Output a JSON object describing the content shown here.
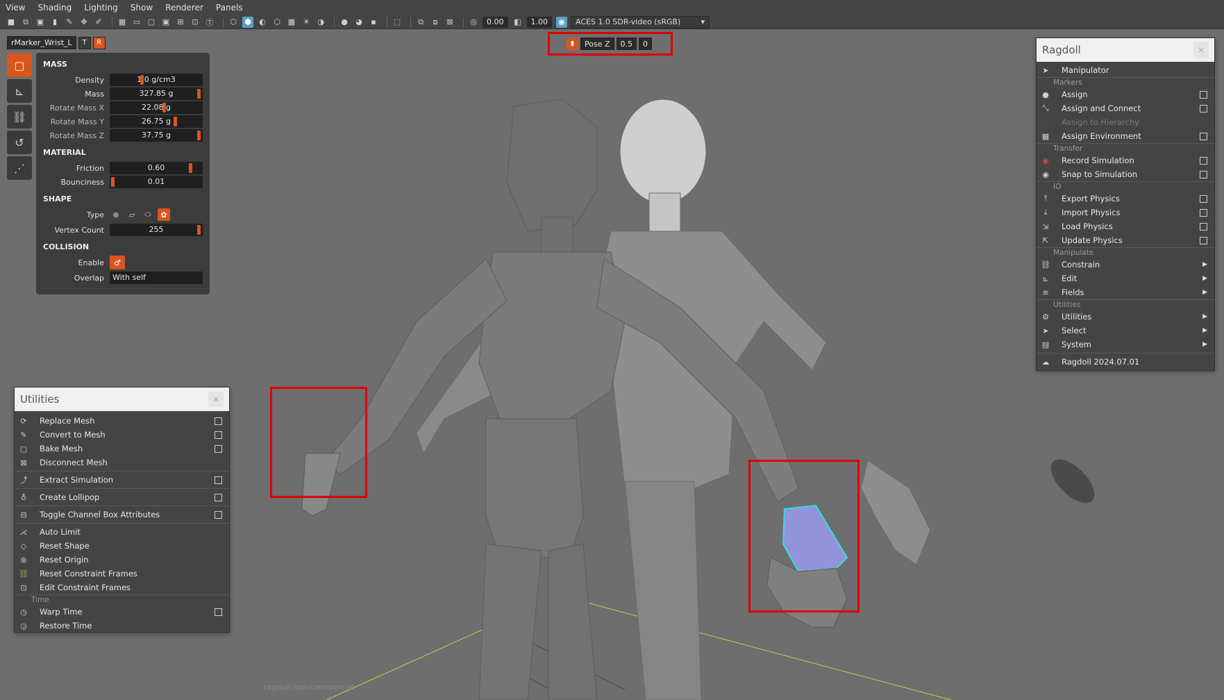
{
  "menubar": {
    "items": [
      "View",
      "Shading",
      "Lighting",
      "Show",
      "Renderer",
      "Panels"
    ]
  },
  "toolbar": {
    "exposure": "0.00",
    "gamma": "1.00",
    "color_space": "ACES 1.0 SDR-video (sRGB)"
  },
  "node": {
    "name": "rMarker_Wrist_L",
    "t_label": "T",
    "r_label": "R"
  },
  "pose_bar": {
    "label": "Pose Z",
    "value": "0.5",
    "frame": "0"
  },
  "attributes": {
    "mass": {
      "title": "MASS",
      "density_label": "Density",
      "density": "1.0 g/cm3",
      "mass_label": "Mass",
      "mass": "327.85 g",
      "rot_x_label": "Rotate Mass X",
      "rot_x": "22.08 g",
      "rot_y_label": "Rotate Mass Y",
      "rot_y": "26.75 g",
      "rot_z_label": "Rotate Mass Z",
      "rot_z": "37.75 g"
    },
    "material": {
      "title": "MATERIAL",
      "friction_label": "Friction",
      "friction": "0.60",
      "bounciness_label": "Bounciness",
      "bounciness": "0.01"
    },
    "shape": {
      "title": "SHAPE",
      "type_label": "Type",
      "vertex_label": "Vertex Count",
      "vertex": "255"
    },
    "collision": {
      "title": "COLLISION",
      "enable_label": "Enable",
      "overlap_label": "Overlap",
      "overlap": "With self"
    }
  },
  "utilities_menu": {
    "title": "Utilities",
    "items": {
      "replace_mesh": "Replace Mesh",
      "convert_mesh": "Convert to Mesh",
      "bake_mesh": "Bake Mesh",
      "disconnect_mesh": "Disconnect Mesh",
      "extract_sim": "Extract Simulation",
      "create_lollipop": "Create Lollipop",
      "toggle_channel": "Toggle Channel Box Attributes",
      "auto_limit": "Auto Limit",
      "reset_shape": "Reset Shape",
      "reset_origin": "Reset Origin",
      "reset_constraint": "Reset Constraint Frames",
      "edit_constraint": "Edit Constraint Frames",
      "time_section": "Time",
      "warp_time": "Warp Time",
      "restore_time": "Restore Time"
    }
  },
  "ragdoll_menu": {
    "title": "Ragdoll",
    "items": {
      "manipulator": "Manipulator",
      "markers_section": "Markers",
      "assign": "Assign",
      "assign_connect": "Assign and Connect",
      "assign_hierarchy": "Assign to Hierarchy",
      "assign_env": "Assign Environment",
      "transfer_section": "Transfer",
      "record_sim": "Record Simulation",
      "snap_sim": "Snap to Simulation",
      "io_section": "IO",
      "export_physics": "Export Physics",
      "import_physics": "Import Physics",
      "load_physics": "Load Physics",
      "update_physics": "Update Physics",
      "manipulate_section": "Manipulate",
      "constrain": "Constrain",
      "edit": "Edit",
      "fields": "Fields",
      "utilities_section": "Utilities",
      "utilities": "Utilities",
      "select": "Select",
      "system": "System",
      "version": "Ragdoll 2024.07.01"
    }
  },
  "watermark": "ragdoll non-commercial",
  "colors": {
    "accent": "#d9551e",
    "highlight": "#e00000",
    "selection": "#9a9af0",
    "panel": "#3c3c3c"
  }
}
